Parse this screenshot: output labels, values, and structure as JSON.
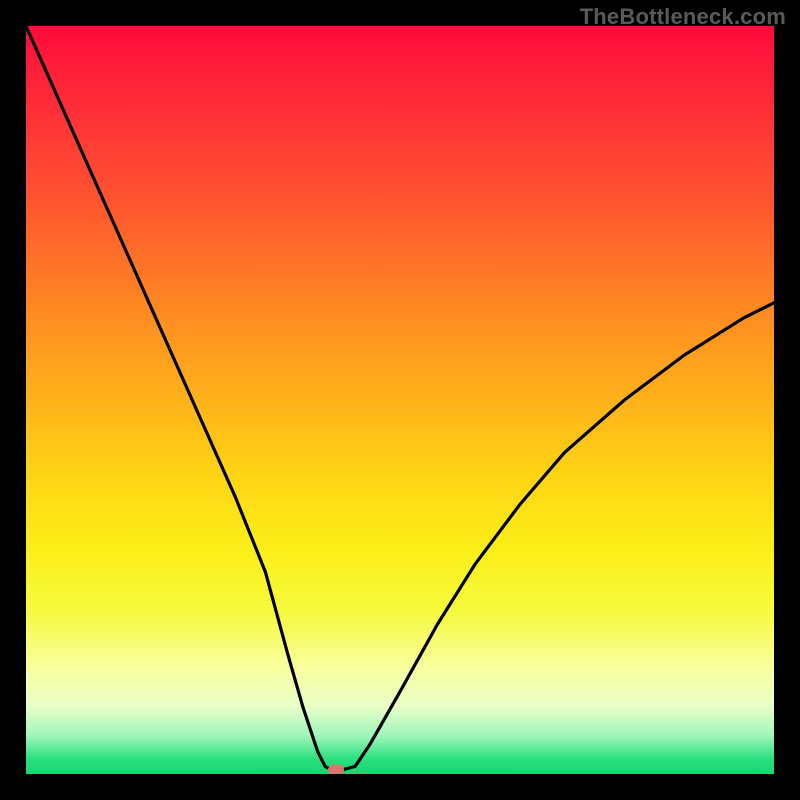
{
  "watermark": "TheBottleneck.com",
  "chart_data": {
    "type": "line",
    "title": "",
    "xlabel": "",
    "ylabel": "",
    "xlim": [
      0,
      100
    ],
    "ylim": [
      0,
      100
    ],
    "grid": false,
    "legend": false,
    "gradient_stops": [
      {
        "pct": 0,
        "color": "#ff0a3a"
      },
      {
        "pct": 15,
        "color": "#ff3a36"
      },
      {
        "pct": 38,
        "color": "#ff8a22"
      },
      {
        "pct": 60,
        "color": "#ffd414"
      },
      {
        "pct": 78,
        "color": "#f6fa3c"
      },
      {
        "pct": 91,
        "color": "#e8ffc8"
      },
      {
        "pct": 100,
        "color": "#17d56f"
      }
    ],
    "series": [
      {
        "name": "bottleneck-curve",
        "x": [
          0,
          4,
          8,
          12,
          16,
          20,
          24,
          28,
          32,
          35,
          37,
          39,
          40,
          41,
          42,
          44,
          46,
          50,
          55,
          60,
          66,
          72,
          80,
          88,
          96,
          100
        ],
        "y": [
          100,
          91,
          82,
          73,
          64,
          55,
          46,
          37,
          27,
          16,
          9,
          3,
          1,
          0.5,
          0.5,
          1,
          4,
          11,
          20,
          28,
          36,
          43,
          50,
          56,
          61,
          63
        ]
      }
    ],
    "min_marker": {
      "x": 41.5,
      "y": 0.5,
      "color": "#d6786e"
    }
  }
}
